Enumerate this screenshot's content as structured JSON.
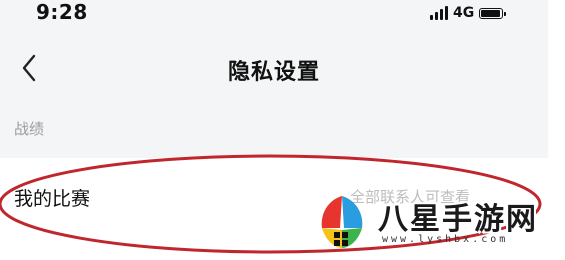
{
  "status_bar": {
    "time": "9:28",
    "network": "4G"
  },
  "nav": {
    "title": "隐私设置",
    "back_icon": "chevron-left-icon"
  },
  "section": {
    "label": "战绩"
  },
  "row": {
    "label": "我的比赛",
    "value": "全部联系人可查看"
  },
  "annotation": {
    "color": "#c0262c"
  },
  "watermark": {
    "brand": "八星手游网",
    "url": "www.lyshbx.com"
  }
}
